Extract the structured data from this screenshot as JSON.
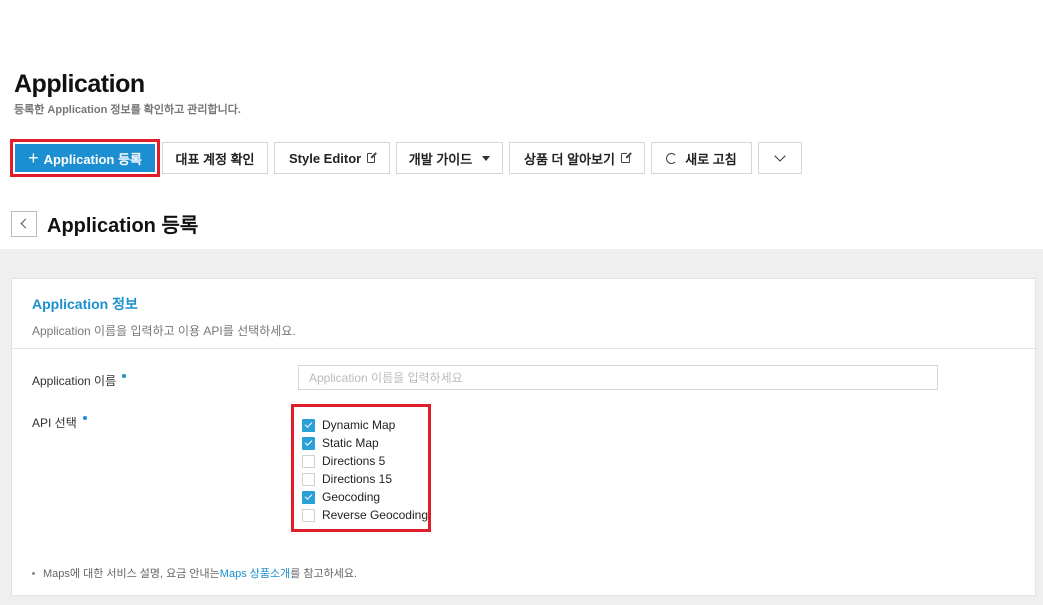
{
  "header": {
    "title": "Application",
    "subtitle": "등록한 Application 정보를 확인하고 관리합니다."
  },
  "toolbar": {
    "register_label": "Application 등록",
    "representative_label": "대표 계정 확인",
    "style_editor_label": "Style Editor",
    "dev_guide_label": "개발 가이드",
    "product_more_label": "상품 더 알아보기",
    "refresh_label": "새로 고침"
  },
  "subheader": {
    "title": "Application 등록"
  },
  "card": {
    "title": "Application 정보",
    "description": "Application 이름을 입력하고 이용 API를 선택하세요.",
    "name_label": "Application 이름",
    "name_value": "",
    "name_placeholder": "Application 이름을 입력하세요",
    "api_label": "API 선택",
    "apis": [
      {
        "label": "Dynamic Map",
        "checked": true
      },
      {
        "label": "Static Map",
        "checked": true
      },
      {
        "label": "Directions 5",
        "checked": false
      },
      {
        "label": "Directions 15",
        "checked": false
      },
      {
        "label": "Geocoding",
        "checked": true
      },
      {
        "label": "Reverse Geocoding",
        "checked": false
      }
    ],
    "note_prefix": "Maps에 대한 서비스 설명, 요금 안내는 ",
    "note_link": "Maps 상품소개",
    "note_suffix": "를 참고하세요."
  },
  "colors": {
    "accent": "#1b8fd1",
    "highlight": "#e01e2b",
    "checkbox": "#2a9fd8"
  }
}
